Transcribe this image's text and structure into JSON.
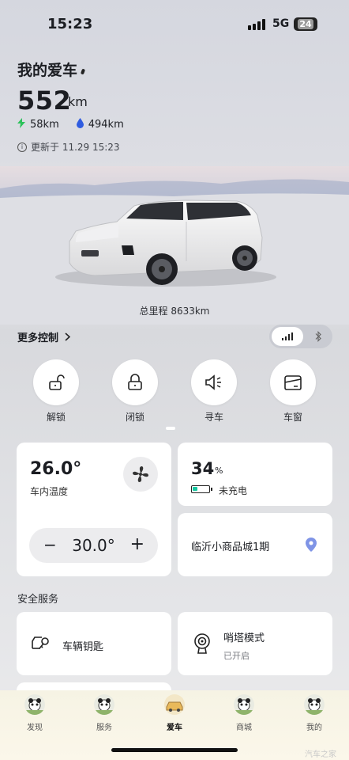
{
  "status_bar": {
    "time": "15:23",
    "network": "5G",
    "battery": "24"
  },
  "car": {
    "title": "我的爱车",
    "range_value": "552",
    "range_unit": "km",
    "electric_range": "58km",
    "fuel_range": "494km",
    "updated": "更新于 11.29 15:23",
    "odometer": "总里程 8633km"
  },
  "controls": {
    "more_label": "更多控制",
    "connection_toggle": {
      "selected": "cellular-icon",
      "other": "bluetooth-icon"
    },
    "buttons": [
      {
        "label": "解锁",
        "icon": "unlock-icon"
      },
      {
        "label": "闭锁",
        "icon": "lock-icon"
      },
      {
        "label": "寻车",
        "icon": "horn-icon"
      },
      {
        "label": "车窗",
        "icon": "window-icon"
      }
    ]
  },
  "climate": {
    "temperature": "26.0°",
    "label": "车内温度",
    "set_temperature": "30.0°",
    "minus": "−",
    "plus": "+"
  },
  "battery": {
    "percent": "34",
    "percent_unit": "%",
    "level": 0.34,
    "status": "未充电",
    "accent": "#16c7a0"
  },
  "location": {
    "name": "临沂小商品城1期"
  },
  "safety": {
    "section_title": "安全服务",
    "items": [
      {
        "label": "车辆钥匙",
        "icon": "car-key-icon"
      },
      {
        "label": "哨塔模式",
        "sub": "已开启",
        "icon": "sentry-icon"
      }
    ]
  },
  "tabbar": {
    "tabs": [
      {
        "label": "发现",
        "active": false
      },
      {
        "label": "服务",
        "active": false
      },
      {
        "label": "爱车",
        "active": true
      },
      {
        "label": "商城",
        "active": false
      },
      {
        "label": "我的",
        "active": false
      }
    ]
  },
  "watermark": "汽车之家"
}
